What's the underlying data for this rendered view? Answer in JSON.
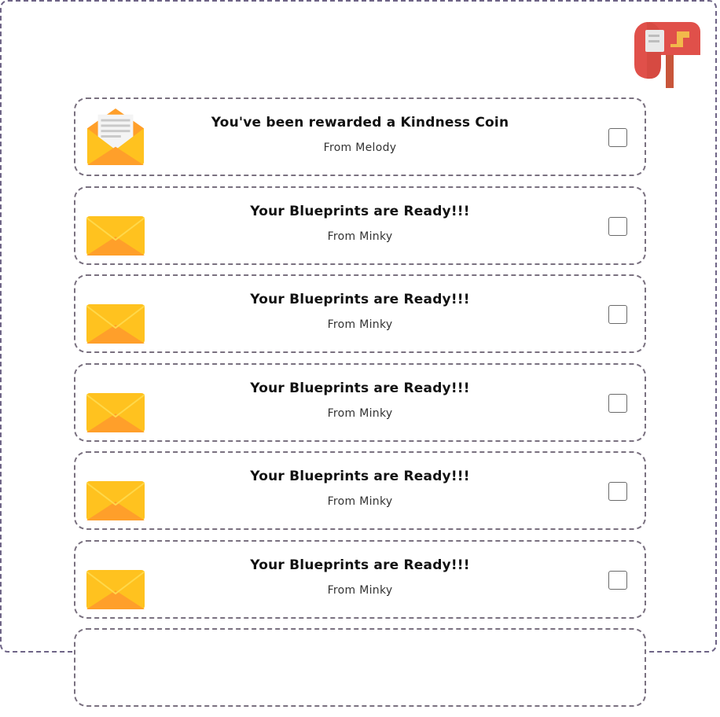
{
  "mailbox": {
    "icon": "mailbox-icon"
  },
  "messages": [
    {
      "title": "You've been rewarded a Kindness Coin",
      "from": "From Melody",
      "icon": "open-envelope-icon",
      "checked": false
    },
    {
      "title": "Your Blueprints are Ready!!!",
      "from": "From Minky",
      "icon": "envelope-icon",
      "checked": false
    },
    {
      "title": "Your Blueprints are Ready!!!",
      "from": "From Minky",
      "icon": "envelope-icon",
      "checked": false
    },
    {
      "title": "Your Blueprints are Ready!!!",
      "from": "From Minky",
      "icon": "envelope-icon",
      "checked": false
    },
    {
      "title": "Your Blueprints are Ready!!!",
      "from": "From Minky",
      "icon": "envelope-icon",
      "checked": false
    },
    {
      "title": "Your Blueprints are Ready!!!",
      "from": "From Minky",
      "icon": "envelope-icon",
      "checked": false
    }
  ],
  "colors": {
    "frame_border": "#6e6486",
    "card_border": "#7a7180",
    "envelope_yellow": "#ffc21f",
    "envelope_orange": "#ff9f2a",
    "mailbox_red": "#e0504a"
  }
}
